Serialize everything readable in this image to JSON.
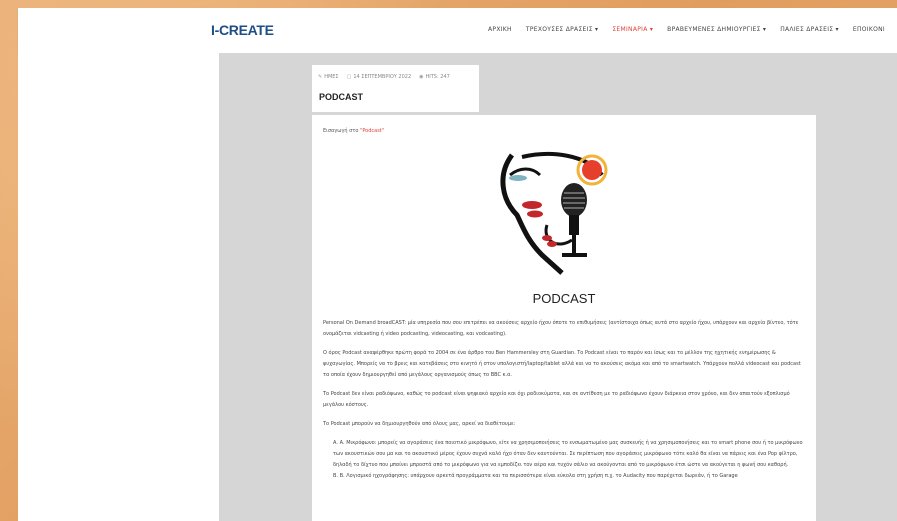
{
  "site": {
    "logo": "I-CREATE"
  },
  "nav": {
    "items": [
      {
        "label": "ΑΡΧΙΚΗ",
        "active": false
      },
      {
        "label": "ΤΡΕΧΟΥΣΕΣ ΔΡΑΣΕΙΣ ▾",
        "active": false
      },
      {
        "label": "ΣΕΜΙΝΑΡΙΑ ▾",
        "active": true
      },
      {
        "label": "ΒΡΑΒΕΥΜΕΝΕΣ ΔΗΜΙΟΥΡΓΙΕΣ ▾",
        "active": false
      },
      {
        "label": "ΠΑΛΙΕΣ ΔΡΑΣΕΙΣ ▾",
        "active": false
      },
      {
        "label": "ΕΠΟΙΚΟΝΙ",
        "active": false
      }
    ]
  },
  "post": {
    "author": "ΗΜΕΣ",
    "date": "14 ΣΕΠΤΕΜΒΡΙΟΥ 2022",
    "hits": "HITS: 247",
    "title": "PODCAST"
  },
  "article": {
    "category_prefix": "Εισαγωγή στο ",
    "category_link": "\"Podcast\"",
    "heading": "PODCAST",
    "paragraphs": [
      "Personal On Demand broadCAST: μία υπηρεσία που σου επιτρέπει να ακούσεις αρχείο ήχου όποτε το επιθυμήσεις (αντίστοιχα όπως αυτά στο αρχείο ήχου, υπάρχουν και αρχεία βίντεο, τότε ονομάζεται vidcasting ή video podcasting, videocasting, και vodcasting).",
      "Ο όρος Podcast αναφέρθηκε πρώτη φορά το 2004 σε ένα άρθρο του Ben Hammersley στη Guardian. Το Podcast είναι το παρόν και ίσως και το μέλλον της ηχητικής ενημέρωσης & ψυχαγωγίας. Μπορείς να το βρεις και κατεβάσεις στο κινητό ή στον υπολογιστή/laptop/tablet αλλά και να το ακούσεις ακόμα και από το smartwatch. Υπάρχουν πολλά videocast και podcast τα οποία έχουν δημιουργηθεί από μεγάλους οργανισμούς όπως το BBC κ.α.",
      "Το Podcast δεν είναι ραδιόφωνο, καθώς το podcast είναι ψηφιακό αρχείο και όχι ραδιοκύματα, και σε αντίθεση με το ραδιόφωνο έχουν διάρκεια στον χρόνο, και δεν απαιτούν εξοπλισμό μεγάλου κόστους.",
      "Το Podcast μπορούν να δημιουργηθούν από όλους μας, αρκεί να διαθέτουμε:"
    ],
    "list": [
      "Α. Α. Μικρόφωνο: μπορείς να αγοράσεις ένα ποιοτικό μικρόφωνο, είτε να χρησιμοποιήσεις το ενσωματωμένο μας συσκευής ή να χρησιμοποιήσεις και το smart phone σου ή το μικρόφωνο των ακουστικών σου μα και το ακουστικό μέρος έχουν συχνά καλό ήχο όταν δεν καυτούνται. Σε περίπτωση που αγοράσεις μικρόφωνο τότε καλό θα είναι να πάρεις και ένα Pop φίλτρο, δηλαδή το δίχτυο που μπαίνει μπροστά από το μικρόφωνο για να εμποδίζει τον αέρα και τυχόν σάλιο να ακούγονται από το μικρόφωνο έτσι ώστε να ακούγεται η φωνή σου καθαρή.",
      "Β. Β. Λογισμικό ηχογράφησης: υπάρχουν αρκετά προγράμματα και τα περισσότερα είναι εύκολα στη χρήση π.χ. το Audacity που παρέχεται δωρεάν, ή το Garage"
    ]
  }
}
